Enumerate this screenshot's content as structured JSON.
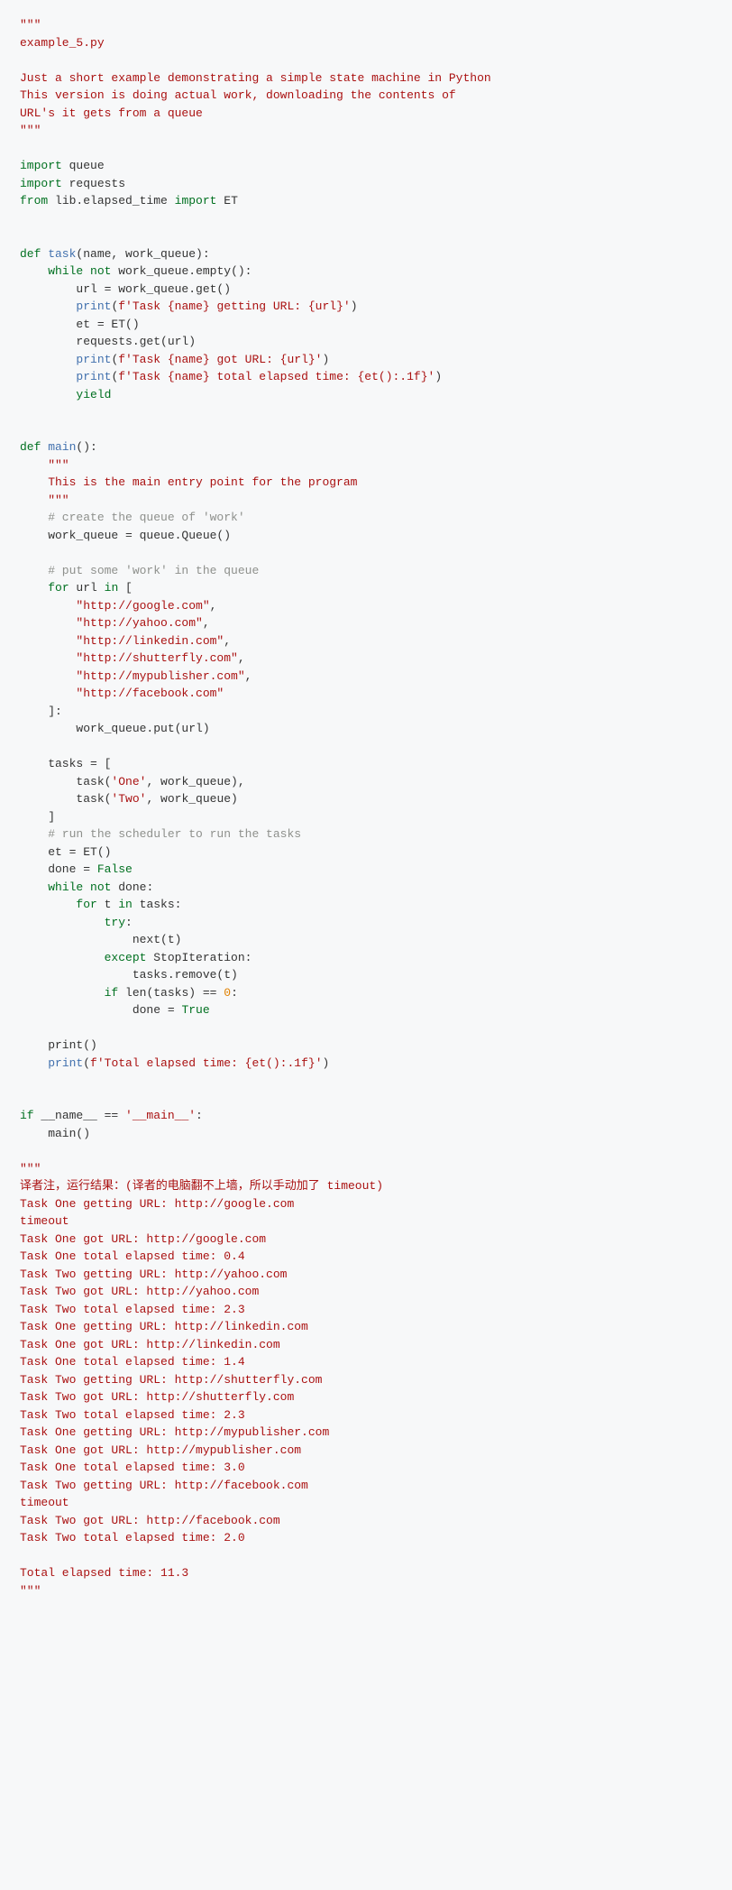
{
  "code": {
    "doc1": "\"\"\"",
    "doc2": "example_5.py",
    "doc3": "",
    "doc4": "Just a short example demonstrating a simple state machine in Python",
    "doc5": "This version is doing actual work, downloading the contents of",
    "doc6": "URL's it gets from a queue",
    "doc7": "\"\"\"",
    "imp1a": "import",
    "imp1b": " queue",
    "imp2a": "import",
    "imp2b": " requests",
    "imp3a": "from",
    "imp3b": " lib.elapsed_time ",
    "imp3c": "import",
    "imp3d": " ET",
    "def": "def",
    "task": " task",
    "taskargs": "(name, work_queue):",
    "while": "while",
    "not": " not",
    "wq": " work_queue.empty():",
    "l_urlget": "        url = work_queue.get()",
    "print": "print",
    "f1a": "(",
    "f1s": "f'Task {name} getting URL: {url}'",
    "f1b": ")",
    "l_et": "        et = ET()",
    "l_reqget": "        requests.get(url)",
    "f2s": "f'Task {name} got URL: {url}'",
    "f3s": "f'Task {name} total elapsed time: {et():.1f}'",
    "yield": "yield",
    "main": " main",
    "mainargs": "():",
    "mdoc1": "    \"\"\"",
    "mdoc2": "    This is the main entry point for the program",
    "mdoc3": "    \"\"\"",
    "cm1": "    # create the queue of 'work'",
    "l_wq": "    work_queue = queue.Queue()",
    "cm2": "    # put some 'work' in the queue",
    "for": "for",
    "forrest": " url ",
    "in": "in",
    "forrest2": " [",
    "u1": "        \"http://google.com\"",
    "comma": ",",
    "u2": "        \"http://yahoo.com\"",
    "u3": "        \"http://linkedin.com\"",
    "u4": "        \"http://shutterfly.com\"",
    "u5": "        \"http://mypublisher.com\"",
    "u6": "        \"http://facebook.com\"",
    "closebr": "    ]:",
    "l_put": "        work_queue.put(url)",
    "l_tasks1": "    tasks = [",
    "l_tasks2a": "        task(",
    "l_tasks2s": "'One'",
    "l_tasks2b": ", work_queue),",
    "l_tasks3a": "        task(",
    "l_tasks3s": "'Two'",
    "l_tasks3b": ", work_queue)",
    "l_tasks4": "    ]",
    "cm3": "    # run the scheduler to run the tasks",
    "l_et2": "    et = ET()",
    "l_done": "    done = ",
    "false": "False",
    "whilenotdone": " done:",
    "forloop2a": "        ",
    "forloop2b": " t ",
    "forloop2c": " tasks:",
    "try": "try",
    "trycolon": ":",
    "l_next": "                next(t)",
    "except": "except",
    "stopiter": " StopIteration:",
    "l_remove": "                tasks.remove(t)",
    "if": "if",
    "iflen": " len(tasks) == ",
    "zero": "0",
    "colon": ":",
    "l_donetrue": "                done = ",
    "true": "True",
    "l_printempty": "    print()",
    "ftotal": "f'Total elapsed time: {et():.1f}'",
    "ifname1": "if",
    "ifname2": " __name__ == ",
    "ifname3": "'__main__'",
    "ifname4": ":",
    "l_main": "    main()",
    "out": {
      "o1": "\"\"\"",
      "o2": "译者注，运行结果：(译者的电脑翻不上墙，所以手动加了 timeout)",
      "o3": "Task One getting URL: http://google.com",
      "o4": "timeout",
      "o5": "Task One got URL: http://google.com",
      "o6": "Task One total elapsed time: 0.4",
      "o7": "Task Two getting URL: http://yahoo.com",
      "o8": "Task Two got URL: http://yahoo.com",
      "o9": "Task Two total elapsed time: 2.3",
      "o10": "Task One getting URL: http://linkedin.com",
      "o11": "Task One got URL: http://linkedin.com",
      "o12": "Task One total elapsed time: 1.4",
      "o13": "Task Two getting URL: http://shutterfly.com",
      "o14": "Task Two got URL: http://shutterfly.com",
      "o15": "Task Two total elapsed time: 2.3",
      "o16": "Task One getting URL: http://mypublisher.com",
      "o17": "Task One got URL: http://mypublisher.com",
      "o18": "Task One total elapsed time: 3.0",
      "o19": "Task Two getting URL: http://facebook.com",
      "o20": "timeout",
      "o21": "Task Two got URL: http://facebook.com",
      "o22": "Task Two total elapsed time: 2.0",
      "o23": "",
      "o24": "Total elapsed time: 11.3",
      "o25": "\"\"\""
    }
  }
}
